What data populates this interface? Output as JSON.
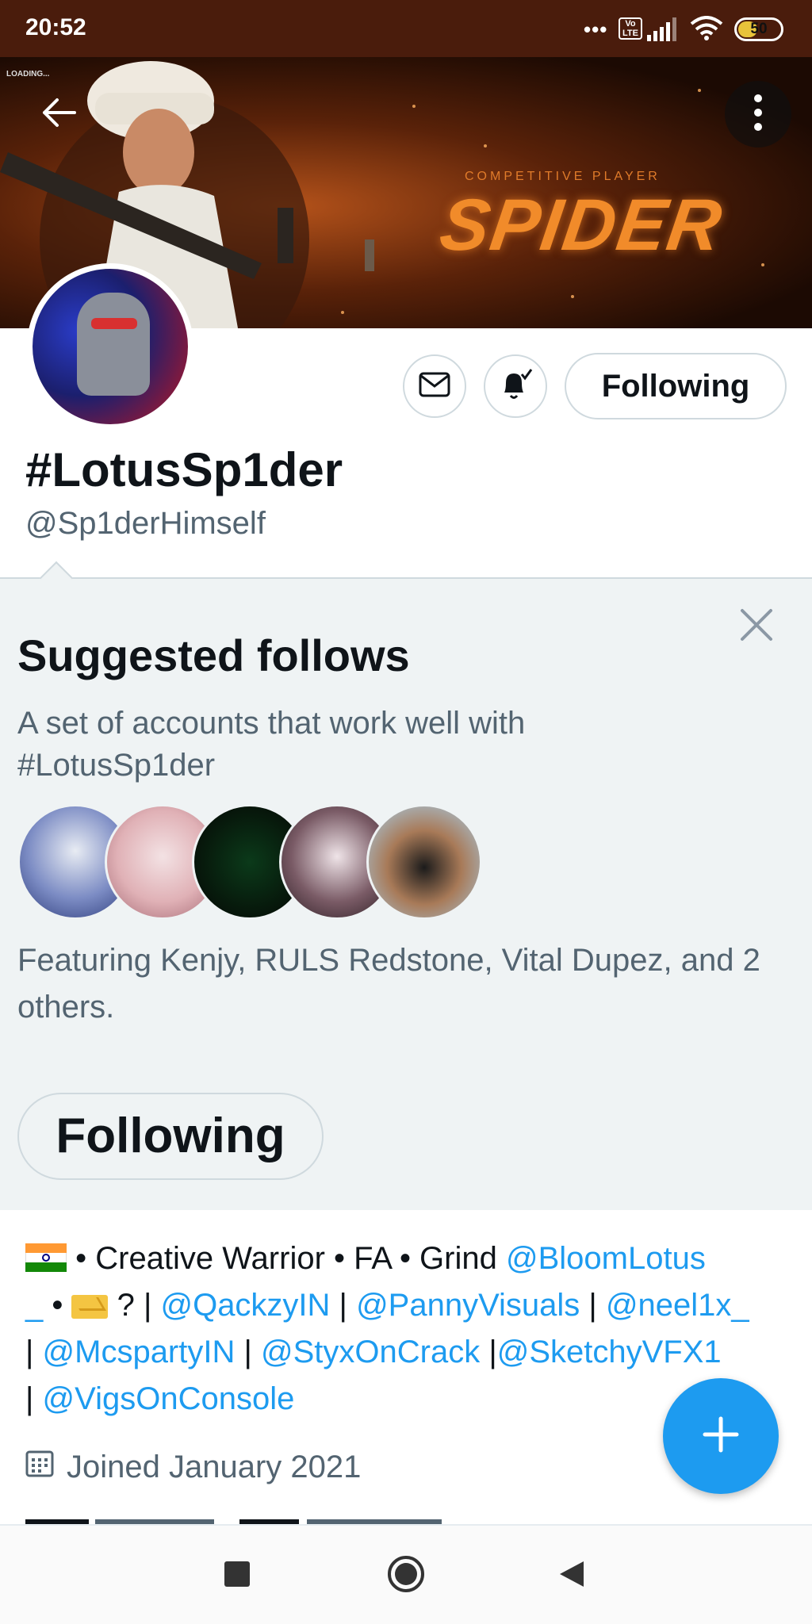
{
  "status_bar": {
    "time": "20:52",
    "network_badge": "Vo LTE",
    "battery": "50",
    "battery_level": 0.5,
    "battery_color": "#e8c33a"
  },
  "banner": {
    "loading_text": "LOADING...",
    "subtitle": "COMPETITIVE PLAYER",
    "brand": "SPIDER",
    "accent_color": "#f18b2a"
  },
  "header": {
    "back_icon": "arrow-left-icon",
    "more_icon": "more-vertical-icon"
  },
  "profile": {
    "display_name": "#LotusSp1der",
    "handle": "@Sp1derHimself",
    "message_icon": "mail-icon",
    "notify_icon": "bell-check-icon",
    "follow_button": "Following"
  },
  "suggested": {
    "title": "Suggested follows",
    "description": "A set of accounts that work well with #LotusSp1der",
    "featuring": "Featuring Kenjy, RULS Redstone, Vital Dupez, and 2 others.",
    "follow_button": "Following",
    "close_icon": "close-icon"
  },
  "bio": {
    "flag_icon": "india-flag-icon",
    "part1": " • Creative Warrior • FA •  Grind ",
    "mention1": "@BloomLotus",
    "mention1b": "_",
    "part2": " • ",
    "envelope_icon": "incoming-envelope-icon",
    "part3": " ? | ",
    "mention2": "@QackzyIN",
    "sep1": " | ",
    "mention3": "@PannyVisuals",
    "sep2": " | ",
    "mention4": "@neel1x_",
    "sep3": "| ",
    "mention5": "@McspartyIN",
    "sep4": " | ",
    "mention6": "@StyxOnCrack",
    "sep5": " |",
    "mention7": "@SketchyVFX1",
    "sep6": "| ",
    "mention8": "@VigsOnConsole",
    "link_color": "#1d9bf0"
  },
  "joined": {
    "icon": "calendar-icon",
    "text": "Joined January 2021"
  },
  "fab": {
    "icon": "plus-icon"
  },
  "navbar": {
    "recents_icon": "square-icon",
    "home_icon": "circle-icon",
    "back_icon": "triangle-back-icon"
  }
}
